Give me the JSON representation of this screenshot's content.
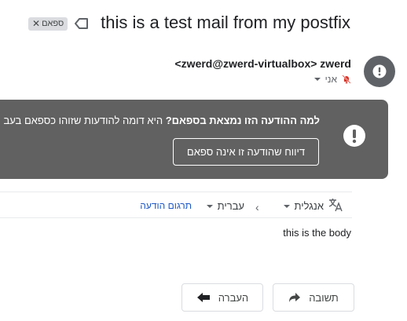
{
  "subject": "this is a test mail from my postfix",
  "labels": [
    {
      "name": "ספאם",
      "remove_symbol": "✕"
    }
  ],
  "icons": {
    "label": "label-arrow-icon",
    "avatar": "alert-circle-icon",
    "banner": "alert-circle-icon",
    "unread_mark": "bell-off-icon",
    "translate": "translate-icon",
    "reply": "reply-arrow-icon",
    "forward": "forward-arrow-icon"
  },
  "sender": {
    "display": "<zwerd@zwerd-virtualbox> zwerd",
    "to_label": "אני"
  },
  "spam_banner": {
    "question": "למה ההודעה הזו נמצאת בספאם?",
    "explanation": "היא דומה להודעות שזוהו כספאם בעב",
    "report_button": "דיווח שהודעה זו אינה ספאם"
  },
  "translate_bar": {
    "from_language": "אנגלית",
    "to_language": "עברית",
    "translate_link": "תרגום הודעה"
  },
  "body": "this is the body",
  "actions": {
    "reply": "תשובה",
    "forward": "העברה"
  },
  "colors": {
    "banner_bg": "#616161",
    "avatar_bg": "#5f6368",
    "link": "#1a56c4",
    "unread_icon": "#d93025"
  }
}
